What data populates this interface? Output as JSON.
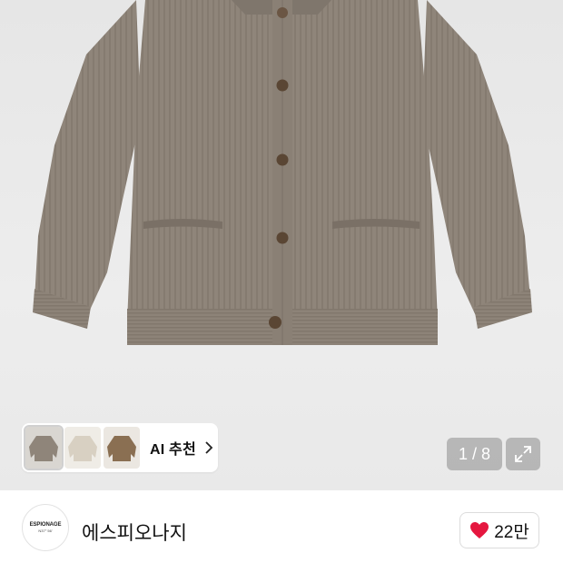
{
  "product": {
    "image_alt": "brown wool button-up cardigan",
    "colors": {
      "knit": "#8f857a",
      "knit_shadow": "#7a7066",
      "button": "#5a4634"
    }
  },
  "recommend": {
    "label": "AI 추천",
    "thumbnails": [
      "cardigan-thumb",
      "cream-knit-thumb",
      "brown-sweater-thumb"
    ]
  },
  "gallery": {
    "pager_text": "1 / 8"
  },
  "brand": {
    "logo_line1": "ESPIONAGE",
    "logo_line2": "N37° 56'",
    "name": "에스피오나지"
  },
  "like": {
    "count": "22만",
    "heart_color": "#e5173f"
  }
}
